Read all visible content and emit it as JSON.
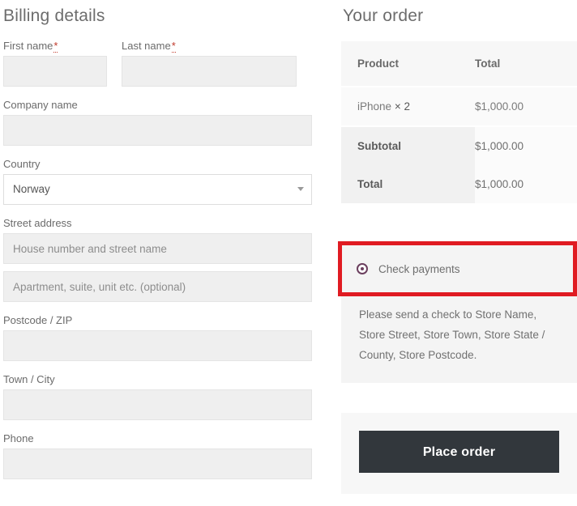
{
  "billing": {
    "title": "Billing details",
    "fields": {
      "first_name": {
        "label": "First name",
        "required_mark": "*",
        "value": "",
        "placeholder": ""
      },
      "last_name": {
        "label": "Last name",
        "required_mark": "*",
        "value": "",
        "placeholder": ""
      },
      "company_name": {
        "label": "Company name",
        "value": "",
        "placeholder": ""
      },
      "country": {
        "label": "Country",
        "value": "Norway",
        "icon": "chevron-down-icon"
      },
      "street_address": {
        "label": "Street address",
        "value": "",
        "placeholder": "House number and street name"
      },
      "address_2": {
        "label": "",
        "value": "",
        "placeholder": "Apartment, suite, unit etc. (optional)"
      },
      "postcode": {
        "label": "Postcode / ZIP",
        "value": "",
        "placeholder": ""
      },
      "city": {
        "label": "Town / City",
        "value": "",
        "placeholder": ""
      },
      "phone": {
        "label": "Phone",
        "value": "",
        "placeholder": ""
      }
    }
  },
  "order": {
    "title": "Your order",
    "table": {
      "headers": [
        "Product",
        "Total"
      ],
      "items": [
        {
          "name": "iPhone",
          "qty": "× 2",
          "total": "$1,000.00"
        }
      ],
      "footer": [
        {
          "label": "Subtotal",
          "value": "$1,000.00"
        },
        {
          "label": "Total",
          "value": "$1,000.00"
        }
      ]
    },
    "payment": {
      "method_label": "Check payments",
      "method_icon": "radio-selected-icon",
      "selected": true,
      "description": "Please send a check to Store Name, Store Street, Store Town, Store State / County, Store Postcode.",
      "highlight_color": "#e01b22"
    },
    "place_order_label": "Place order"
  }
}
